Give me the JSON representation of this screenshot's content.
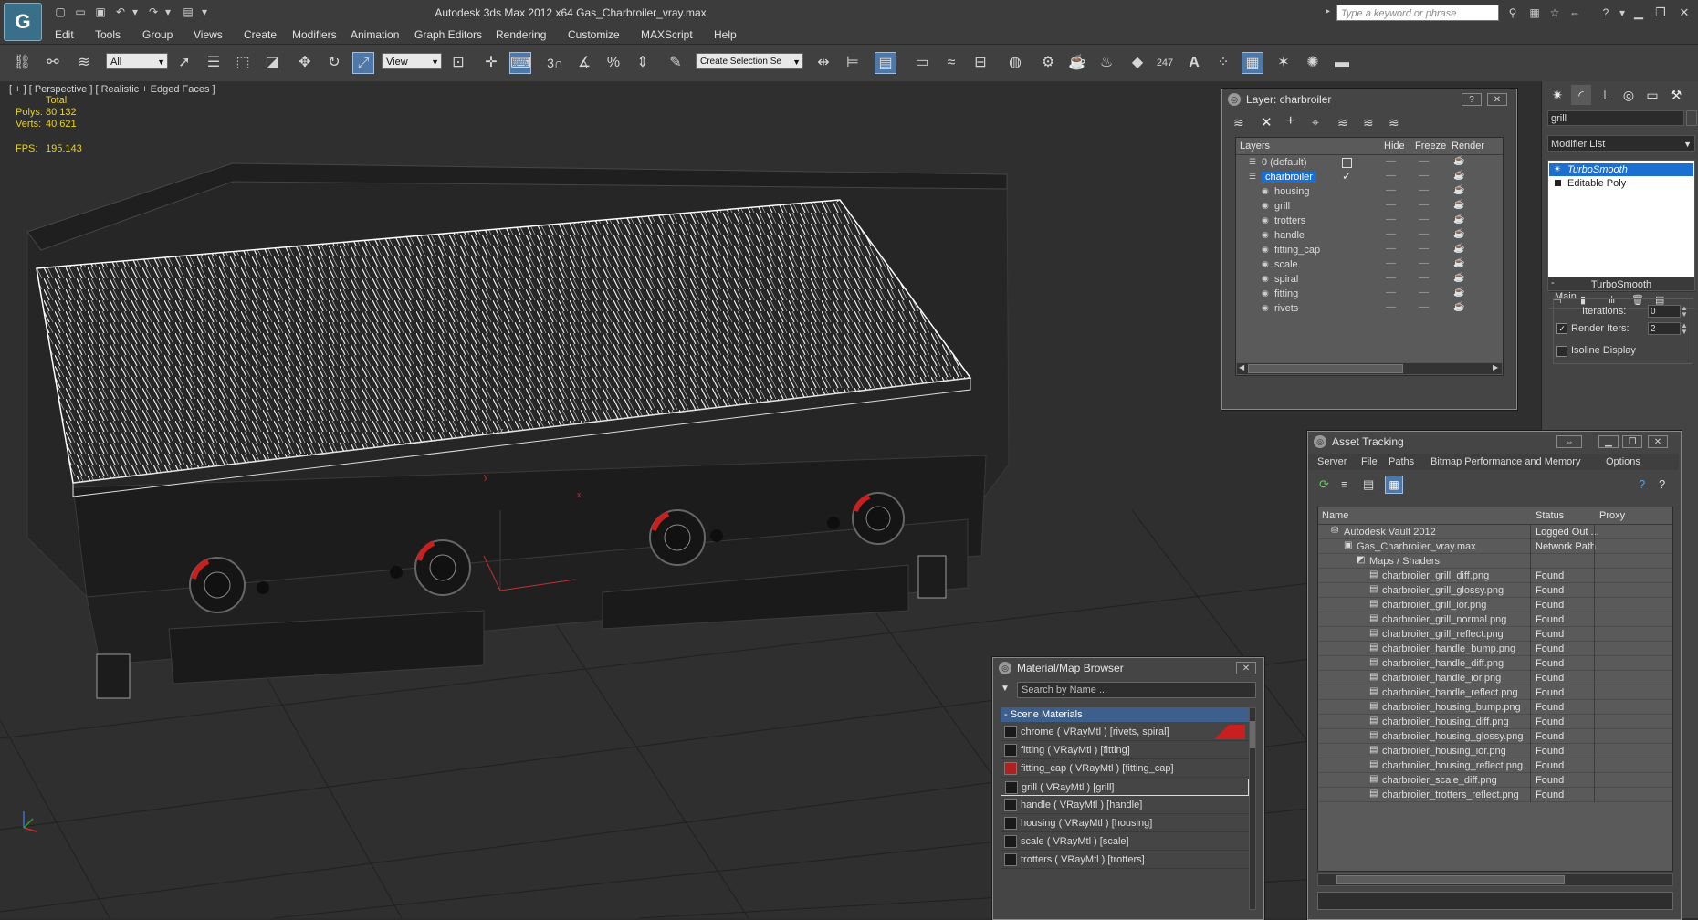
{
  "titlebar": {
    "title": "Autodesk 3ds Max  2012 x64      Gas_Charbroiler_vray.max",
    "search_placeholder": "Type a keyword or phrase"
  },
  "menu": [
    "Edit",
    "Tools",
    "Group",
    "Views",
    "Create",
    "Modifiers",
    "Animation",
    "Graph Editors",
    "Rendering",
    "Customize",
    "MAXScript",
    "Help"
  ],
  "toolbar": {
    "selection_filter": "All",
    "reference_coord": "View",
    "snap_label": "3",
    "named_selection": "Create Selection Se",
    "polycount_icon": "247"
  },
  "viewport": {
    "label": "[ + ] [ Perspective ] [ Realistic + Edged Faces ]",
    "stats": {
      "total_label": "Total",
      "polys_label": "Polys:",
      "polys": "80 132",
      "verts_label": "Verts:",
      "verts": "40 621",
      "fps_label": "FPS:",
      "fps": "195.143"
    },
    "axis_labels": {
      "x": "x",
      "y": "y",
      "z": "z"
    }
  },
  "command_panel": {
    "object_name": "grill",
    "modifier_list": "Modifier List",
    "stack": [
      "TurboSmooth",
      "Editable Poly"
    ],
    "rollout_title": "TurboSmooth",
    "group_main": "Main",
    "iterations_label": "Iterations:",
    "iterations_value": "0",
    "render_iters_label": "Render Iters:",
    "render_iters_value": "2",
    "isoline_label": "Isoline Display"
  },
  "layer_dialog": {
    "title": "Layer: charbroiler",
    "columns": [
      "Layers",
      "Hide",
      "Freeze",
      "Render"
    ],
    "rows": [
      {
        "name": "0 (default)",
        "level": 0
      },
      {
        "name": "charbroiler",
        "level": 0,
        "selected": true
      },
      {
        "name": "housing",
        "level": 1
      },
      {
        "name": "grill",
        "level": 1
      },
      {
        "name": "trotters",
        "level": 1
      },
      {
        "name": "handle",
        "level": 1
      },
      {
        "name": "fitting_cap",
        "level": 1
      },
      {
        "name": "scale",
        "level": 1
      },
      {
        "name": "spiral",
        "level": 1
      },
      {
        "name": "fitting",
        "level": 1
      },
      {
        "name": "rivets",
        "level": 1
      }
    ]
  },
  "asset_tracking": {
    "title": "Asset Tracking",
    "menu": [
      "Server",
      "File",
      "Paths",
      "Bitmap Performance and Memory",
      "Options"
    ],
    "columns": [
      "Name",
      "Status",
      "Proxy"
    ],
    "rows": [
      {
        "name": "Autodesk Vault 2012",
        "status": "Logged Out ...",
        "level": 0,
        "icon": "vault-icon"
      },
      {
        "name": "Gas_Charbroiler_vray.max",
        "status": "Network Path",
        "level": 1,
        "icon": "max-file-icon"
      },
      {
        "name": "Maps / Shaders",
        "status": "",
        "level": 2,
        "icon": "maps-icon"
      },
      {
        "name": "charbroiler_grill_diff.png",
        "status": "Found",
        "level": 3,
        "icon": "bitmap-icon"
      },
      {
        "name": "charbroiler_grill_glossy.png",
        "status": "Found",
        "level": 3,
        "icon": "bitmap-icon"
      },
      {
        "name": "charbroiler_grill_ior.png",
        "status": "Found",
        "level": 3,
        "icon": "bitmap-icon"
      },
      {
        "name": "charbroiler_grill_normal.png",
        "status": "Found",
        "level": 3,
        "icon": "bitmap-icon"
      },
      {
        "name": "charbroiler_grill_reflect.png",
        "status": "Found",
        "level": 3,
        "icon": "bitmap-icon"
      },
      {
        "name": "charbroiler_handle_bump.png",
        "status": "Found",
        "level": 3,
        "icon": "bitmap-icon"
      },
      {
        "name": "charbroiler_handle_diff.png",
        "status": "Found",
        "level": 3,
        "icon": "bitmap-icon"
      },
      {
        "name": "charbroiler_handle_ior.png",
        "status": "Found",
        "level": 3,
        "icon": "bitmap-icon"
      },
      {
        "name": "charbroiler_handle_reflect.png",
        "status": "Found",
        "level": 3,
        "icon": "bitmap-icon"
      },
      {
        "name": "charbroiler_housing_bump.png",
        "status": "Found",
        "level": 3,
        "icon": "bitmap-icon"
      },
      {
        "name": "charbroiler_housing_diff.png",
        "status": "Found",
        "level": 3,
        "icon": "bitmap-icon"
      },
      {
        "name": "charbroiler_housing_glossy.png",
        "status": "Found",
        "level": 3,
        "icon": "bitmap-icon"
      },
      {
        "name": "charbroiler_housing_ior.png",
        "status": "Found",
        "level": 3,
        "icon": "bitmap-icon"
      },
      {
        "name": "charbroiler_housing_reflect.png",
        "status": "Found",
        "level": 3,
        "icon": "bitmap-icon"
      },
      {
        "name": "charbroiler_scale_diff.png",
        "status": "Found",
        "level": 3,
        "icon": "bitmap-icon"
      },
      {
        "name": "charbroiler_trotters_reflect.png",
        "status": "Found",
        "level": 3,
        "icon": "bitmap-icon"
      }
    ]
  },
  "material_browser": {
    "title": "Material/Map Browser",
    "search_placeholder": "Search by Name ...",
    "group": "- Scene Materials",
    "items": [
      "chrome  ( VRayMtl ) [rivets, spiral]",
      "fitting  ( VRayMtl ) [fitting]",
      "fitting_cap  ( VRayMtl ) [fitting_cap]",
      "grill  ( VRayMtl ) [grill]",
      "handle  ( VRayMtl ) [handle]",
      "housing  ( VRayMtl ) [housing]",
      "scale  ( VRayMtl ) [scale]",
      "trotters  ( VRayMtl ) [trotters]"
    ]
  },
  "colors": {
    "selection_blue": "#1a6fd0",
    "viewport_stats": "#e7d21e",
    "knob_red": "#c82020"
  }
}
